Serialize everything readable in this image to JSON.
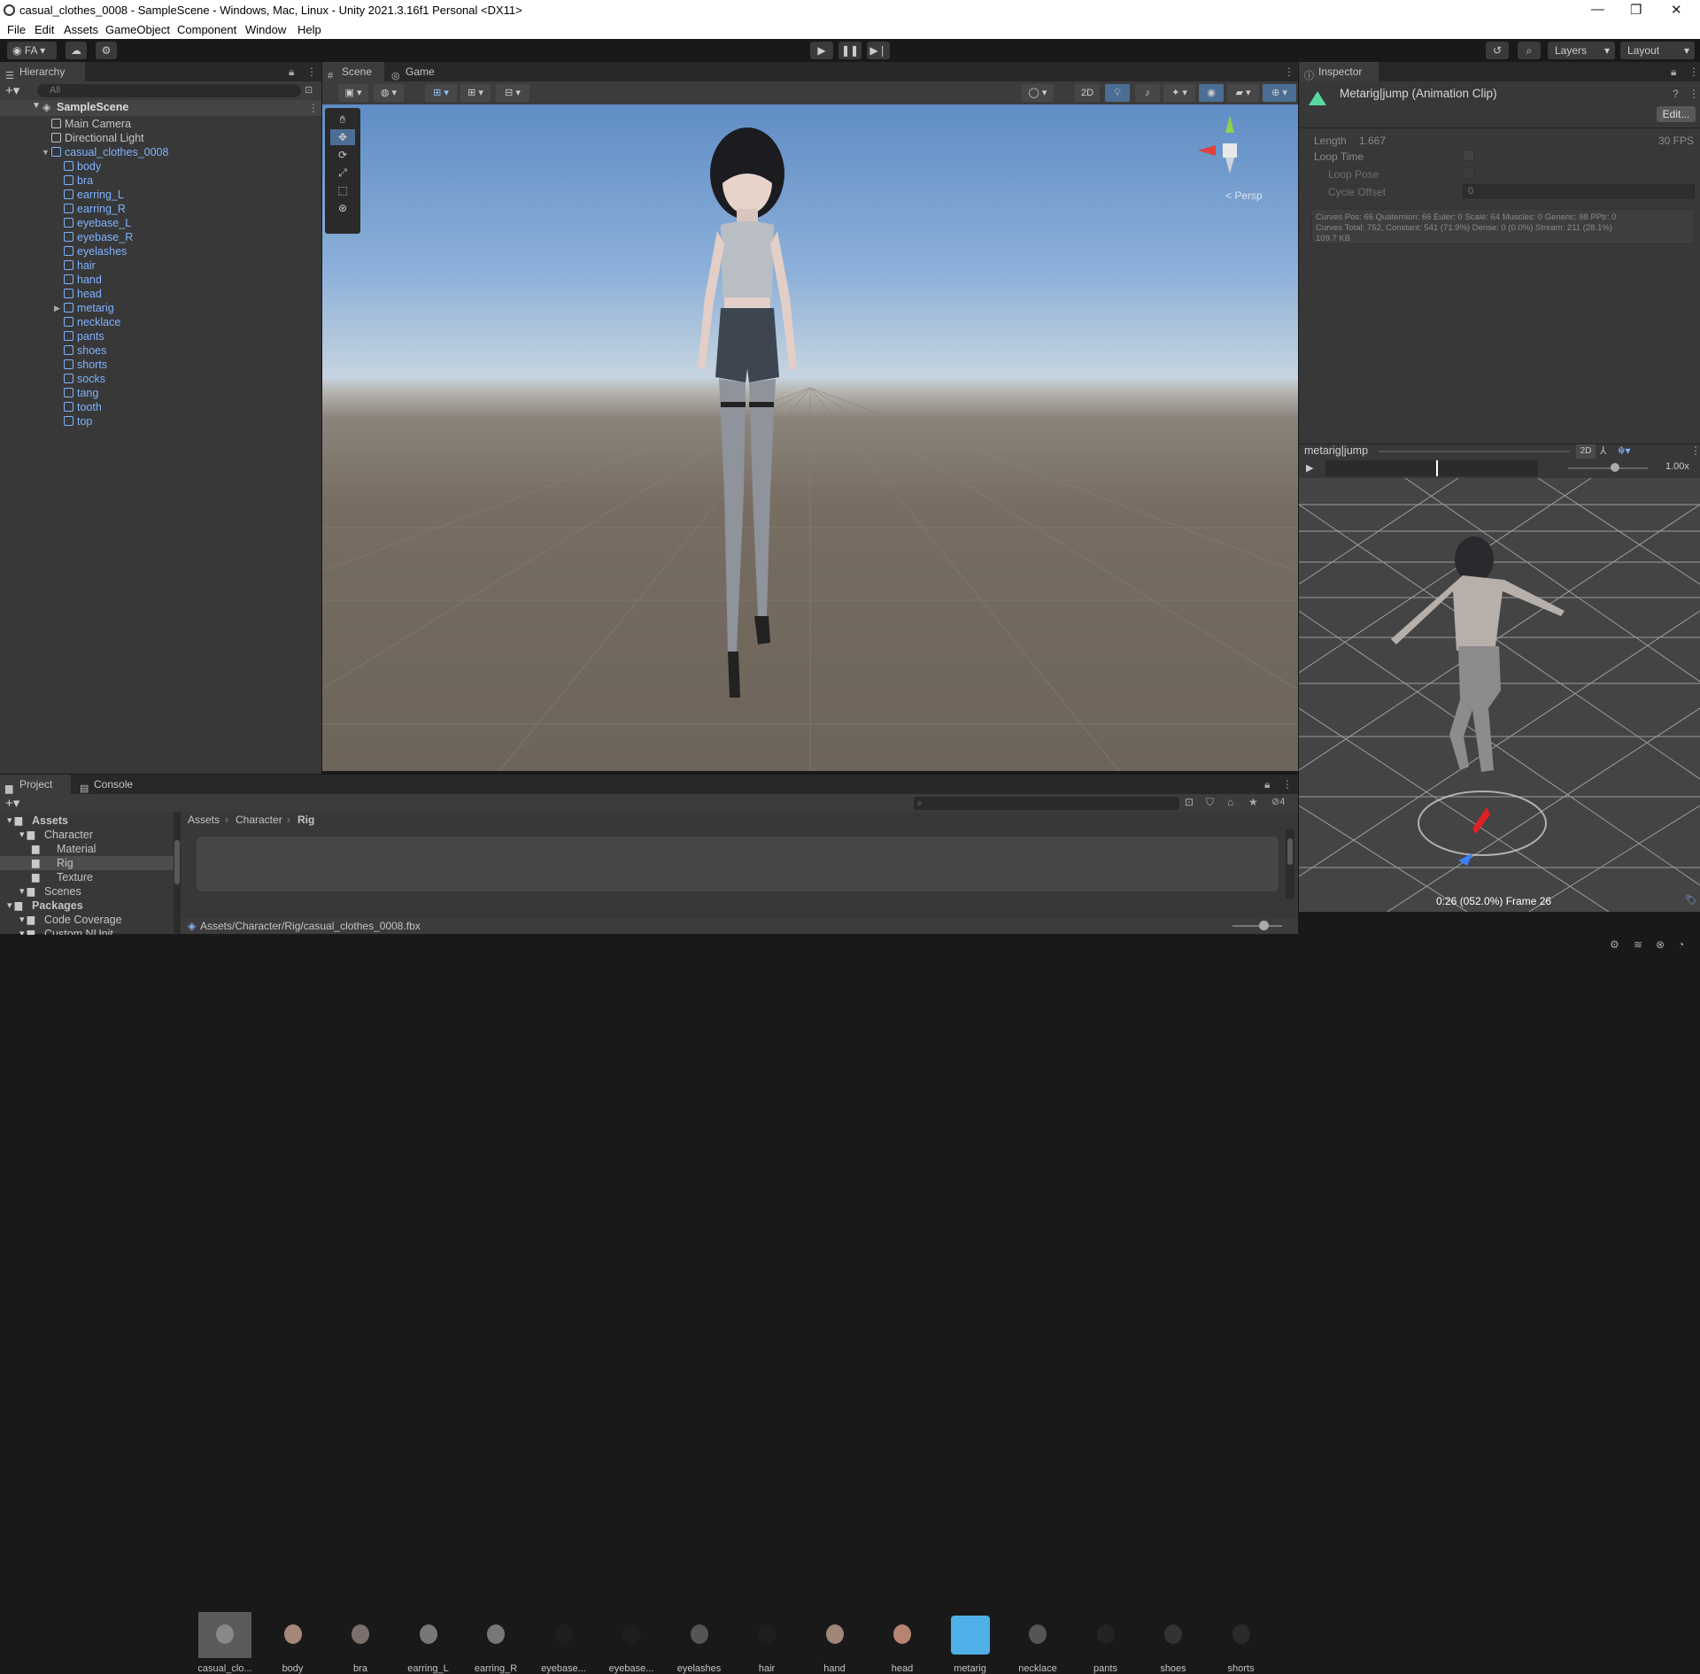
{
  "window": {
    "title": "casual_clothes_0008 - SampleScene - Windows, Mac, Linux - Unity 2021.3.16f1 Personal <DX11>",
    "min": "—",
    "max": "❐",
    "close": "✕"
  },
  "menu": [
    "File",
    "Edit",
    "Assets",
    "GameObject",
    "Component",
    "Window",
    "Help"
  ],
  "toolbar": {
    "account": "FA",
    "layers": "Layers",
    "layout": "Layout"
  },
  "hierarchy": {
    "tab": "Hierarchy",
    "search_placeholder": "All",
    "scene": "SampleScene",
    "items": [
      {
        "label": "Main Camera",
        "indent": 1,
        "blue": false
      },
      {
        "label": "Directional Light",
        "indent": 1,
        "blue": false
      },
      {
        "label": "casual_clothes_0008",
        "indent": 1,
        "blue": true,
        "expanded": true
      },
      {
        "label": "body",
        "indent": 2,
        "blue": true
      },
      {
        "label": "bra",
        "indent": 2,
        "blue": true
      },
      {
        "label": "earring_L",
        "indent": 2,
        "blue": true
      },
      {
        "label": "earring_R",
        "indent": 2,
        "blue": true
      },
      {
        "label": "eyebase_L",
        "indent": 2,
        "blue": true
      },
      {
        "label": "eyebase_R",
        "indent": 2,
        "blue": true
      },
      {
        "label": "eyelashes",
        "indent": 2,
        "blue": true
      },
      {
        "label": "hair",
        "indent": 2,
        "blue": true
      },
      {
        "label": "hand",
        "indent": 2,
        "blue": true
      },
      {
        "label": "head",
        "indent": 2,
        "blue": true
      },
      {
        "label": "metarig",
        "indent": 2,
        "blue": true,
        "collapsed": true
      },
      {
        "label": "necklace",
        "indent": 2,
        "blue": true
      },
      {
        "label": "pants",
        "indent": 2,
        "blue": true
      },
      {
        "label": "shoes",
        "indent": 2,
        "blue": true
      },
      {
        "label": "shorts",
        "indent": 2,
        "blue": true
      },
      {
        "label": "socks",
        "indent": 2,
        "blue": true
      },
      {
        "label": "tang",
        "indent": 2,
        "blue": true
      },
      {
        "label": "tooth",
        "indent": 2,
        "blue": true
      },
      {
        "label": "top",
        "indent": 2,
        "blue": true
      }
    ]
  },
  "scene": {
    "tab_scene": "Scene",
    "tab_game": "Game",
    "mode2d": "2D",
    "persp": "< Persp"
  },
  "inspector": {
    "tab": "Inspector",
    "clip_title": "Metarig|jump (Animation Clip)",
    "edit": "Edit...",
    "length_label": "Length",
    "length_value": "1.667",
    "fps": "30 FPS",
    "loop_time": "Loop Time",
    "loop_pose": "Loop Pose",
    "cycle_offset": "Cycle Offset",
    "cycle_value": "0",
    "curves1": "Curves Pos: 66 Quaternion: 66 Euler: 0 Scale: 64 Muscles: 0 Generic: 98 PPtr: 0",
    "curves2": "Curves Total: 752, Constant: 541 (71.9%) Dense: 0 (0.0%) Stream: 211 (28.1%)",
    "size": "109.7 KB"
  },
  "preview": {
    "title": "metarig|jump",
    "mode2d": "2D",
    "speed": "1.00x",
    "frame_info": "0:26 (052.0%) Frame 26",
    "progress": 0.52
  },
  "project": {
    "tab_project": "Project",
    "tab_console": "Console",
    "hidden_count": "4",
    "tree": [
      {
        "label": "Assets",
        "indent": 0,
        "bold": true
      },
      {
        "label": "Character",
        "indent": 1
      },
      {
        "label": "Material",
        "indent": 2
      },
      {
        "label": "Rig",
        "indent": 2,
        "selected": true
      },
      {
        "label": "Texture",
        "indent": 2
      },
      {
        "label": "Scenes",
        "indent": 1
      },
      {
        "label": "Packages",
        "indent": 0,
        "bold": true
      },
      {
        "label": "Code Coverage",
        "indent": 1
      },
      {
        "label": "Custom NUnit",
        "indent": 1
      }
    ],
    "breadcrumb": [
      "Assets",
      "Character",
      "Rig"
    ],
    "assets": [
      "casual_clo...",
      "body",
      "bra",
      "earring_L",
      "earring_R",
      "eyebase...",
      "eyebase...",
      "eyelashes",
      "hair",
      "hand",
      "head",
      "metarig",
      "necklace",
      "pants",
      "shoes",
      "shorts"
    ],
    "path": "Assets/Character/Rig/casual_clothes_0008.fbx"
  }
}
